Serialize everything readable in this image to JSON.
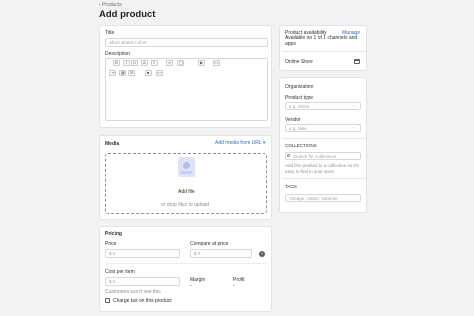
{
  "header": {
    "back_label": "‹ Products",
    "title": "Add product"
  },
  "main": {
    "title_label": "Title",
    "title_placeholder": "Short sleeve t-shirt",
    "description_label": "Description",
    "media": {
      "title": "Media",
      "add_url": "Add media from URL ▾",
      "add_file": "Add file",
      "drop_hint": "or drop files to upload"
    },
    "pricing": {
      "title": "Pricing",
      "price_label": "Price",
      "price_value": "$ 0",
      "compare_label": "Compare at price",
      "compare_value": "$ 0",
      "cost_label": "Cost per item",
      "cost_value": "$ 0",
      "margin_label": "Margin",
      "margin_value": "-",
      "profit_label": "Profit",
      "profit_value": "-",
      "customers_note": "Customers won't see this",
      "charge_tax": "Charge tax on this product"
    }
  },
  "sidebar": {
    "availability": {
      "title": "Product availability",
      "manage": "Manage",
      "desc": "Available on 1 of 1 channels and apps",
      "channel": "Online Store"
    },
    "organization": {
      "title": "Organization",
      "type_label": "Product type",
      "type_placeholder": "e.g. Shirts",
      "vendor_label": "Vendor",
      "vendor_placeholder": "e.g. Nike",
      "collections_title": "COLLECTIONS",
      "collections_placeholder": "Search for collections",
      "collections_hint": "Add this product to a collection so it's easy to find in your store.",
      "tags_title": "TAGS",
      "tags_placeholder": "Vintage, cotton, summer"
    }
  },
  "icons": [
    "bold-icon",
    "italic-icon",
    "underline-icon",
    "color-icon",
    "align-icon",
    "link-icon",
    "image-icon",
    "video-icon",
    "code-icon",
    "upload-icon",
    "calendar-icon",
    "help-icon",
    "chevron-icon"
  ]
}
